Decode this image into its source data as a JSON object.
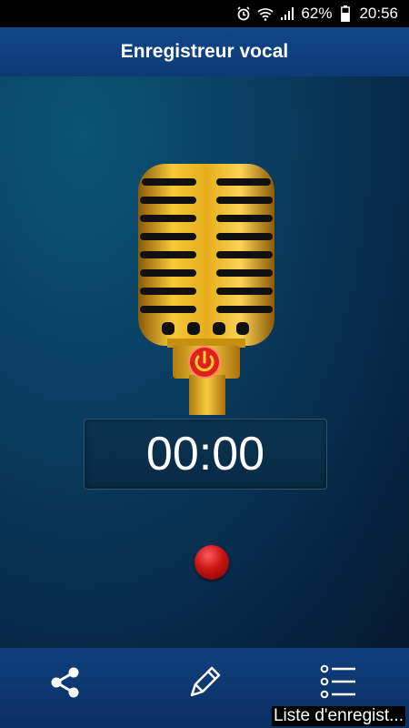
{
  "status_bar": {
    "battery_percent": "62%",
    "time": "20:56",
    "icons": [
      "alarm-icon",
      "wifi-icon",
      "signal-icon",
      "battery-icon"
    ]
  },
  "header": {
    "title": "Enregistreur vocal"
  },
  "recorder": {
    "timer": "00:00",
    "record_button": "record-dot"
  },
  "bottom_bar": {
    "share_icon": "share-icon",
    "edit_icon": "pencil-icon",
    "list_icon": "list-icon",
    "list_label": "Liste d'enregist..."
  },
  "colors": {
    "title_bar": "#0d3a75",
    "background": "#0a3f63",
    "record": "#c81414",
    "mic_gold": "#e8b020"
  }
}
